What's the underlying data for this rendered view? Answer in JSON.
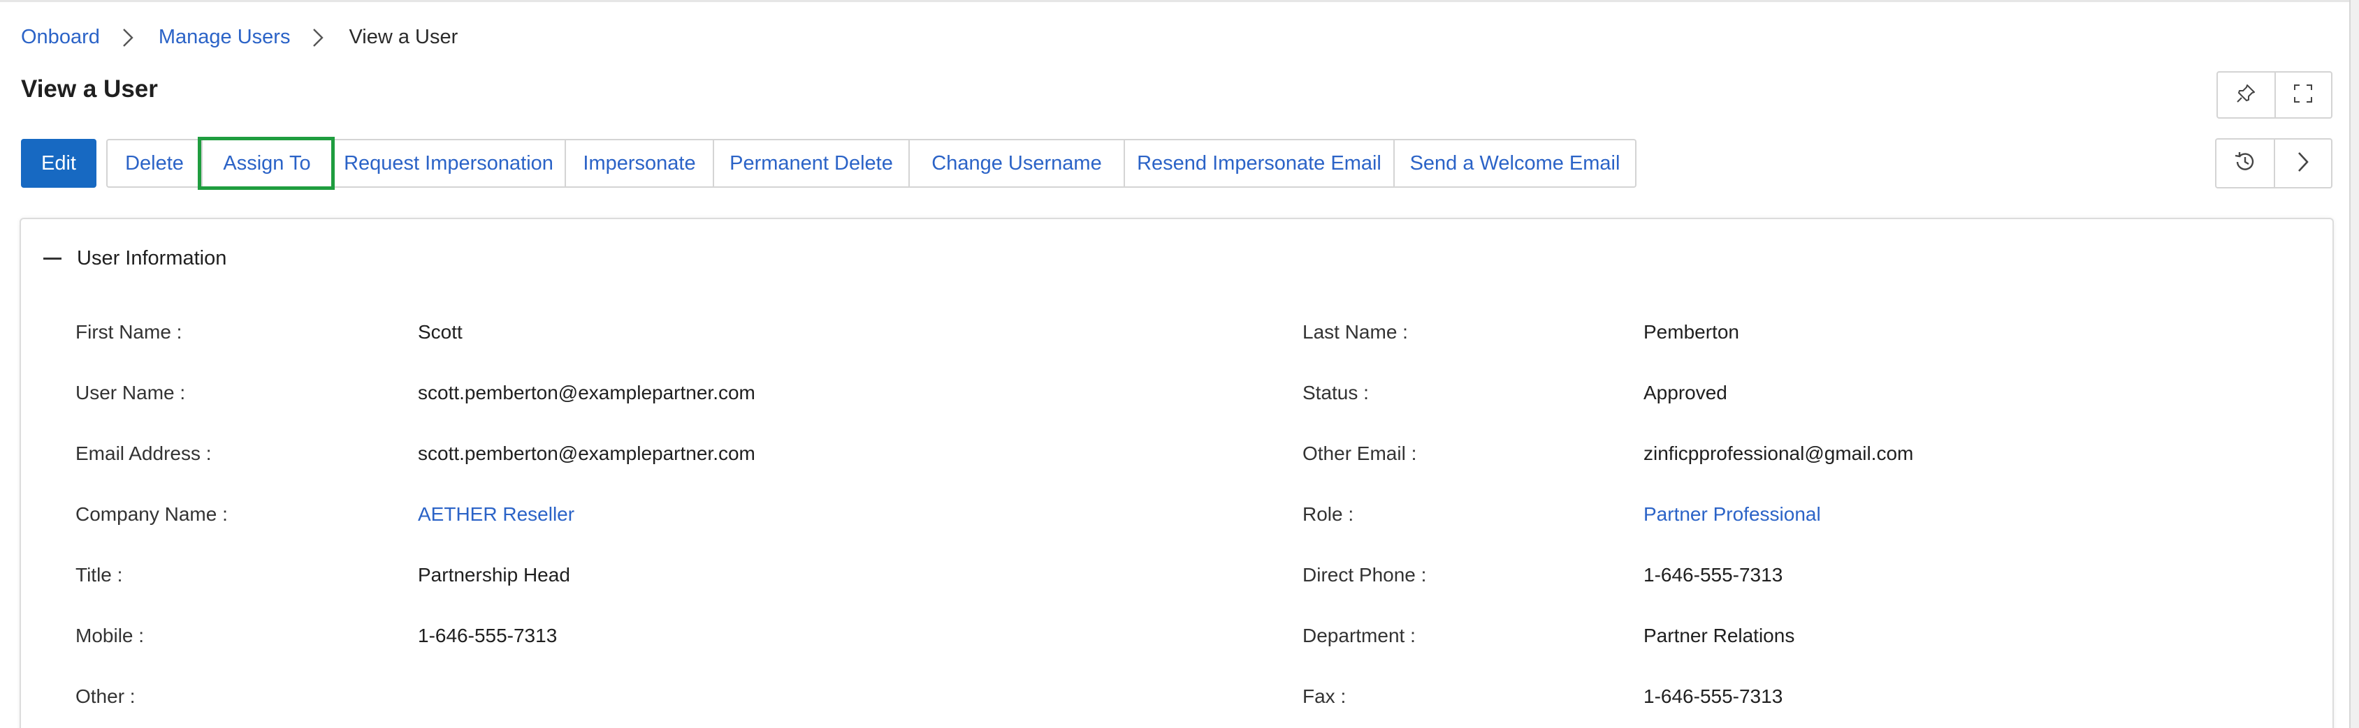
{
  "breadcrumb": {
    "items": [
      "Onboard",
      "Manage Users"
    ],
    "current": "View a User"
  },
  "page": {
    "title": "View a User"
  },
  "toolbar": {
    "edit_label": "Edit",
    "buttons": [
      "Delete",
      "Assign To",
      "Request Impersonation",
      "Impersonate",
      "Permanent Delete",
      "Change Username",
      "Resend Impersonate Email",
      "Send a Welcome Email"
    ],
    "highlighted_button": "Assign To"
  },
  "icons": {
    "pin": "pin-icon",
    "fullscreen": "fullscreen-icon",
    "history": "history-icon",
    "next": "chevron-right-icon",
    "collapse": "minus-icon"
  },
  "colors": {
    "primary": "#1769c2",
    "link": "#2b63c7",
    "highlight": "#1f9d3f",
    "border": "#d4d4d4"
  },
  "section": {
    "title": "User Information",
    "left_fields": [
      {
        "label": "First Name :",
        "value": "Scott",
        "link": false
      },
      {
        "label": "User Name :",
        "value": "scott.pemberton@examplepartner.com",
        "link": false
      },
      {
        "label": "Email Address :",
        "value": "scott.pemberton@examplepartner.com",
        "link": false
      },
      {
        "label": "Company Name :",
        "value": "AETHER Reseller",
        "link": true
      },
      {
        "label": "Title :",
        "value": "Partnership Head",
        "link": false
      },
      {
        "label": "Mobile :",
        "value": "1-646-555-7313",
        "link": false
      },
      {
        "label": "Other :",
        "value": "",
        "link": false
      }
    ],
    "right_fields": [
      {
        "label": "Last Name :",
        "value": "Pemberton",
        "link": false
      },
      {
        "label": "Status :",
        "value": "Approved",
        "link": false
      },
      {
        "label": "Other Email :",
        "value": "zinficpprofessional@gmail.com",
        "link": false
      },
      {
        "label": "Role :",
        "value": "Partner Professional",
        "link": true
      },
      {
        "label": "Direct Phone :",
        "value": "1-646-555-7313",
        "link": false
      },
      {
        "label": "Department :",
        "value": "Partner Relations",
        "link": false
      },
      {
        "label": "Fax :",
        "value": "1-646-555-7313",
        "link": false
      }
    ]
  }
}
